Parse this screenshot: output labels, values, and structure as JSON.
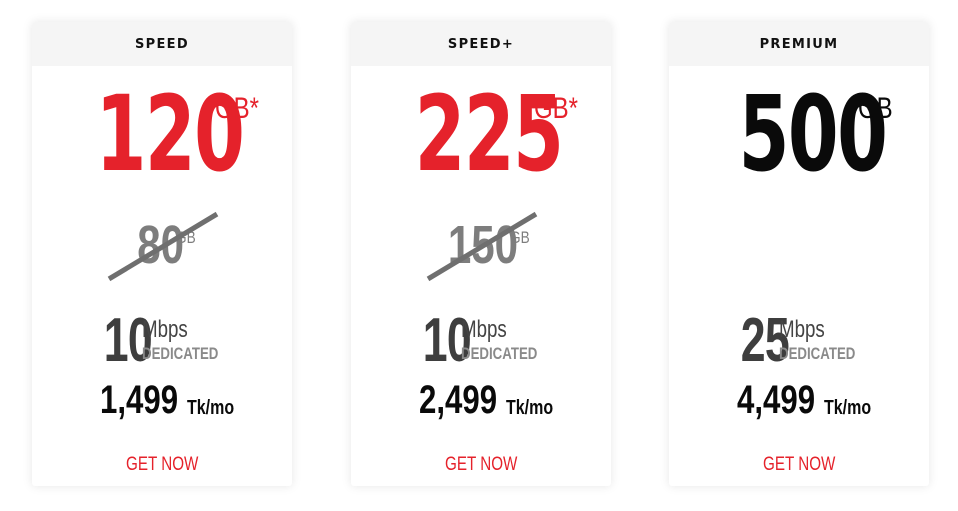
{
  "plans": [
    {
      "name": "SPEED",
      "volume": "120",
      "volume_unit": "GB*",
      "old_volume": "80",
      "old_unit": "GB",
      "speed": "10",
      "speed_unit": "Mbps",
      "speed_type": "DEDICATED",
      "price": "1,499",
      "price_unit": "Tk/mo",
      "cta": "GET NOW",
      "volume_color": "#e5222b"
    },
    {
      "name": "SPEED+",
      "volume": "225",
      "volume_unit": "GB*",
      "old_volume": "150",
      "old_unit": "GB",
      "speed": "10",
      "speed_unit": "Mbps",
      "speed_type": "DEDICATED",
      "price": "2,499",
      "price_unit": "Tk/mo",
      "cta": "GET NOW",
      "volume_color": "#e5222b"
    },
    {
      "name": "PREMIUM",
      "volume": "500",
      "volume_unit": "GB",
      "speed": "25",
      "speed_unit": "Mbps",
      "speed_type": "DEDICATED",
      "price": "4,499",
      "price_unit": "Tk/mo",
      "cta": "GET NOW",
      "volume_color": "#0a0a0a"
    }
  ],
  "colors": {
    "accent": "#e5222b",
    "header_bg": "#f5f5f5",
    "muted": "#7d7d7d"
  }
}
